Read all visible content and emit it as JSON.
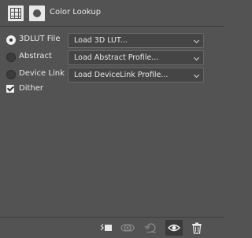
{
  "header": {
    "title": "Color Lookup",
    "adjustment_icon": "grid-adjustment-icon",
    "mask_icon": "layer-mask-icon"
  },
  "options": [
    {
      "label": "3DLUT File",
      "selected": true,
      "dropdown_value": "Load 3D LUT..."
    },
    {
      "label": "Abstract",
      "selected": false,
      "dropdown_value": "Load Abstract Profile..."
    },
    {
      "label": "Device Link",
      "selected": false,
      "dropdown_value": "Load DeviceLink Profile..."
    }
  ],
  "dither": {
    "label": "Dither",
    "checked": true
  },
  "footer": {
    "buttons": [
      {
        "name": "clip-to-layer-icon"
      },
      {
        "name": "view-previous-state-icon"
      },
      {
        "name": "reset-icon"
      },
      {
        "name": "visibility-eye-icon"
      },
      {
        "name": "trash-icon"
      }
    ]
  },
  "colors": {
    "panel_bg": "#535353",
    "dropdown_bg": "#454545",
    "text": "#e0e0e0"
  }
}
